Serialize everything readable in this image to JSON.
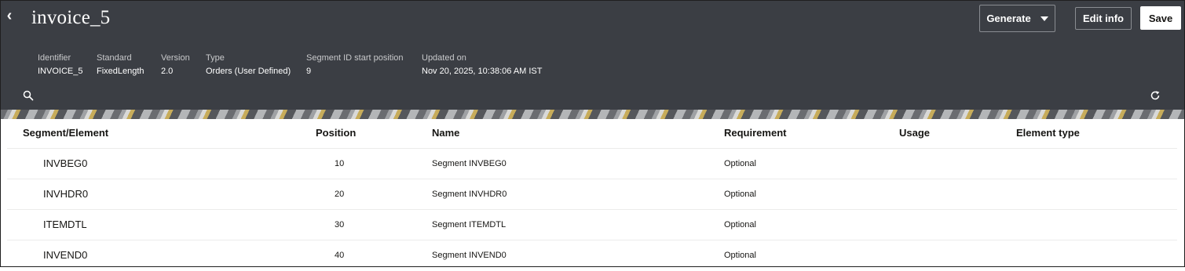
{
  "header": {
    "title": "invoice_5",
    "buttons": {
      "generate": "Generate",
      "edit_info": "Edit info",
      "save": "Save"
    },
    "meta": [
      {
        "label": "Identifier",
        "value": "INVOICE_5"
      },
      {
        "label": "Standard",
        "value": "FixedLength"
      },
      {
        "label": "Version",
        "value": "2.0"
      },
      {
        "label": "Type",
        "value": "Orders (User Defined)"
      },
      {
        "label": "Segment ID start position",
        "value": "9"
      },
      {
        "label": "Updated on",
        "value": "Nov 20, 2025, 10:38:06 AM IST"
      }
    ],
    "icons": {
      "back": "chevron-left-icon",
      "search": "search-icon",
      "refresh": "refresh-icon"
    }
  },
  "table": {
    "columns": [
      "Segment/Element",
      "Position",
      "Name",
      "Requirement",
      "Usage",
      "Element type"
    ],
    "rows": [
      {
        "segment": "INVBEG0",
        "position": "10",
        "name": "Segment INVBEG0",
        "requirement": "Optional",
        "usage": "",
        "element_type": ""
      },
      {
        "segment": "INVHDR0",
        "position": "20",
        "name": "Segment INVHDR0",
        "requirement": "Optional",
        "usage": "",
        "element_type": ""
      },
      {
        "segment": "ITEMDTL",
        "position": "30",
        "name": "Segment ITEMDTL",
        "requirement": "Optional",
        "usage": "",
        "element_type": ""
      },
      {
        "segment": "INVEND0",
        "position": "40",
        "name": "Segment INVEND0",
        "requirement": "Optional",
        "usage": "",
        "element_type": ""
      }
    ]
  },
  "colors": {
    "header_bg": "#3b3e44",
    "accent_gold": "#c7ac5a"
  }
}
